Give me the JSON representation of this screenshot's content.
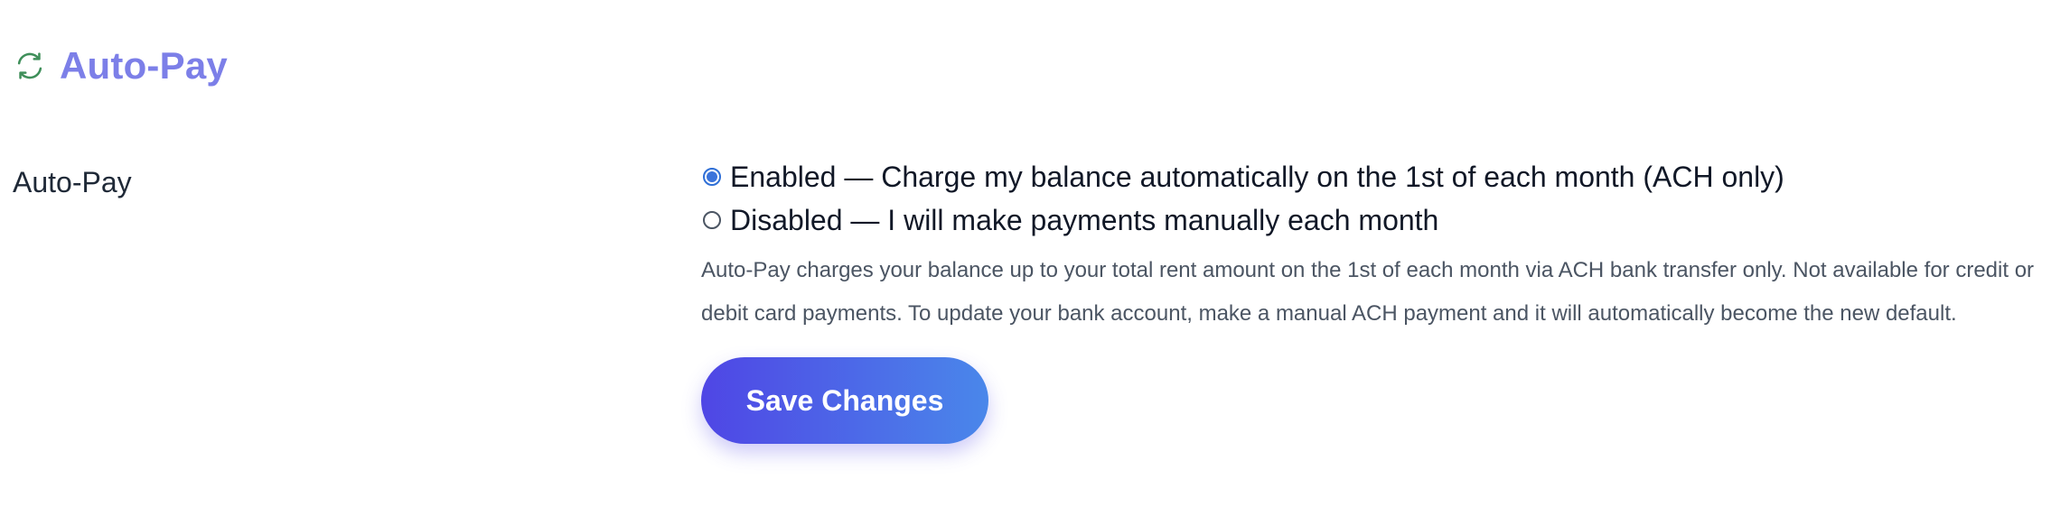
{
  "section": {
    "icon": "refresh-icon",
    "title": "Auto-Pay"
  },
  "field": {
    "label": "Auto-Pay"
  },
  "options": [
    {
      "label": "Enabled — Charge my balance automatically on the 1st of each month (ACH only)",
      "selected": true
    },
    {
      "label": "Disabled — I will make payments manually each month",
      "selected": false
    }
  ],
  "help_text": "Auto-Pay charges your balance up to your total rent amount on the 1st of each month via ACH bank transfer only. Not available for credit or debit card payments. To update your bank account, make a manual ACH payment and it will automatically become the new default.",
  "save_button": {
    "label": "Save Changes"
  },
  "colors": {
    "title": "#7c7fe8",
    "icon": "#3f8f5a",
    "radio_selected": "#3b74db",
    "button_gradient_start": "#4f46e5",
    "button_gradient_end": "#4a87ea"
  }
}
